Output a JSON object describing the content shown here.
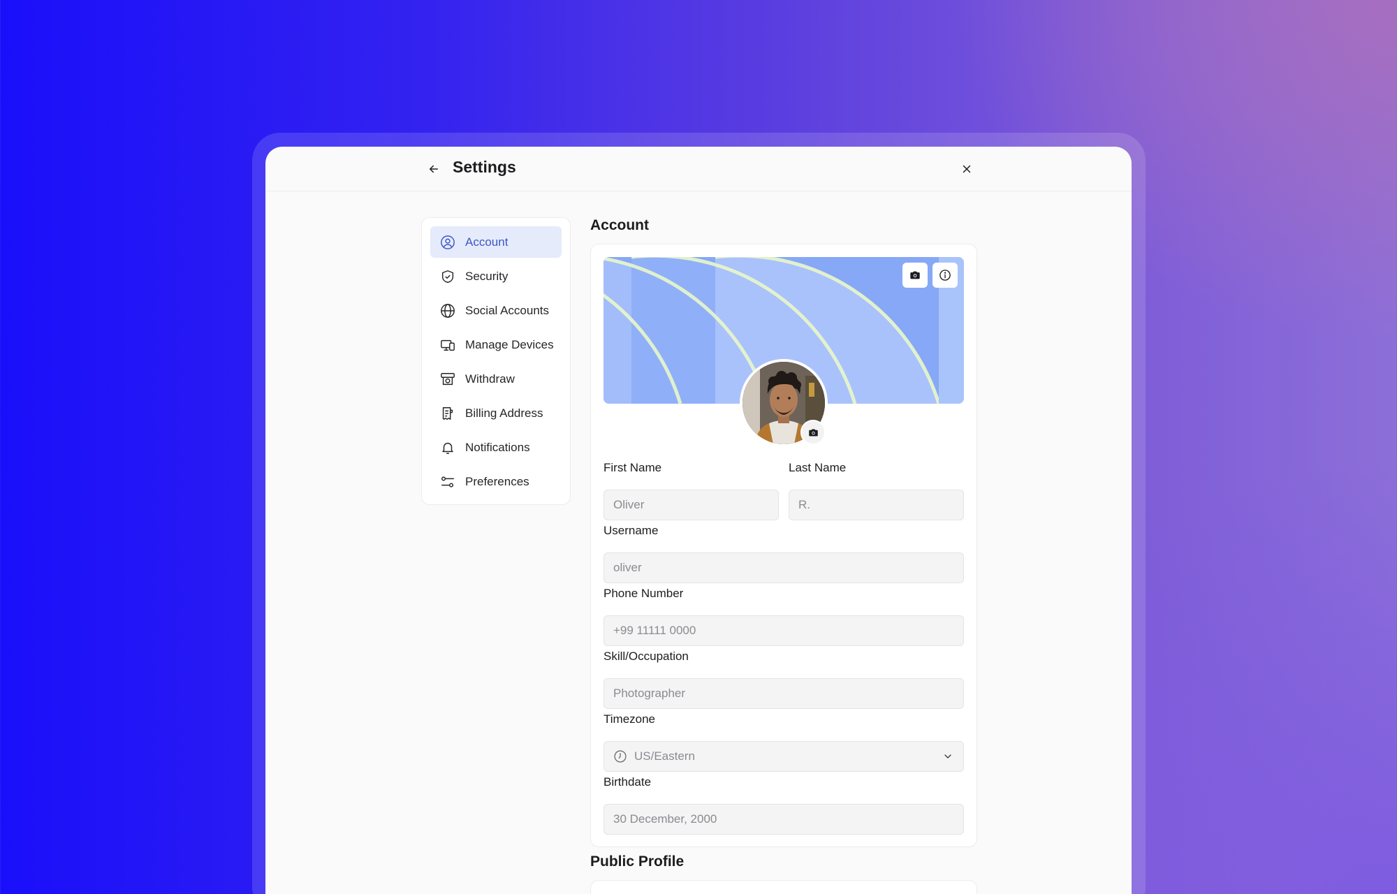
{
  "header": {
    "title": "Settings",
    "back_icon": "arrow-left-icon",
    "close_icon": "close-icon"
  },
  "sidebar": {
    "items": [
      {
        "label": "Account",
        "icon": "user-circle-icon",
        "active": true
      },
      {
        "label": "Security",
        "icon": "shield-check-icon",
        "active": false
      },
      {
        "label": "Social Accounts",
        "icon": "globe-icon",
        "active": false
      },
      {
        "label": "Manage Devices",
        "icon": "devices-icon",
        "active": false
      },
      {
        "label": "Withdraw",
        "icon": "withdraw-icon",
        "active": false
      },
      {
        "label": "Billing Address",
        "icon": "receipt-icon",
        "active": false
      },
      {
        "label": "Notifications",
        "icon": "bell-icon",
        "active": false
      },
      {
        "label": "Preferences",
        "icon": "sliders-icon",
        "active": false
      }
    ]
  },
  "account": {
    "section_title": "Account",
    "banner_icons": [
      "camera-icon",
      "info-icon"
    ],
    "fields": {
      "first_name": {
        "label": "First Name",
        "value": "Oliver"
      },
      "last_name": {
        "label": "Last Name",
        "value": "R."
      },
      "username": {
        "label": "Username",
        "value": "oliver"
      },
      "phone": {
        "label": "Phone Number",
        "value": "+99 11111 0000"
      },
      "skill": {
        "label": "Skill/Occupation",
        "value": "Photographer"
      },
      "timezone": {
        "label": "Timezone",
        "value": "US/Eastern"
      },
      "birthdate": {
        "label": "Birthdate",
        "value": "30 December, 2000"
      }
    }
  },
  "public_profile": {
    "section_title": "Public Profile"
  },
  "colors": {
    "accent": "#3c58c6",
    "active_bg": "#e6ebfb",
    "input_bg": "#f4f4f5"
  }
}
